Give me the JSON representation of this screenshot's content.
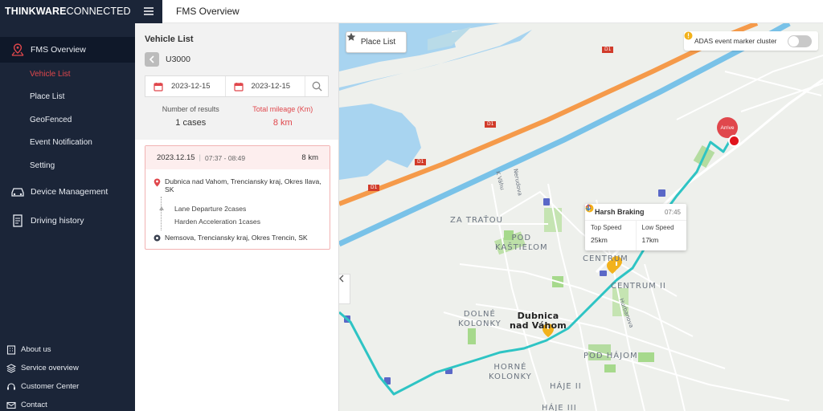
{
  "brand": {
    "bold": "THINKWARE",
    "light": "CONNECTED"
  },
  "header": {
    "title": "FMS Overview"
  },
  "sidebar": {
    "main_label": "FMS Overview",
    "sub_items": [
      {
        "label": "Vehicle List"
      },
      {
        "label": "Place List"
      },
      {
        "label": "GeoFenced"
      },
      {
        "label": "Event Notification"
      },
      {
        "label": "Setting"
      }
    ],
    "device_management": "Device Management",
    "driving_history": "Driving history",
    "bottom_links": [
      {
        "label": "About us",
        "icon": "building-icon"
      },
      {
        "label": "Service overview",
        "icon": "layers-icon"
      },
      {
        "label": "Customer Center",
        "icon": "headset-icon"
      },
      {
        "label": "Contact",
        "icon": "mail-icon"
      }
    ]
  },
  "panel": {
    "title": "Vehicle List",
    "vehicle": "U3000",
    "date_from": "2023-12-15",
    "date_to": "2023-12-15",
    "stats": {
      "results_label": "Number of results",
      "results_value": "1 cases",
      "mileage_label": "Total mileage (Km)",
      "mileage_value": "8 km"
    },
    "trip": {
      "date": "2023.12.15",
      "time": "07:37 - 08:49",
      "distance": "8 km",
      "start": "Dubnica nad Vahom, Trenciansky kraj, Okres Ilava, SK",
      "events": [
        "Lane Departure 2cases",
        "Harden Acceleration 1cases"
      ],
      "end": "Nemsova, Trenciansky kraj, Okres Trencin, SK"
    }
  },
  "map": {
    "place_list_button": "Place List",
    "adas_toggle_label": "ADAS event marker cluster",
    "adas_toggle_on": false,
    "popup": {
      "title": "Harsh Braking",
      "time": "07:45",
      "top_speed_label": "Top Speed",
      "top_speed_value": "25km",
      "low_speed_label": "Low Speed",
      "low_speed_value": "17km"
    },
    "arrive_label": "Arrive",
    "road_labels": [
      "D1",
      "D1",
      "D1",
      "D1",
      "D1"
    ],
    "place_labels": {
      "za_tratou": "ZA TRAŤOU",
      "pod_kastielom": "POD\nKAŠTIEĽOM",
      "centrum": "CENTRUM",
      "centrum_ii": "CENTRUM II",
      "dolne_kolonky": "DOLNÉ\nKOLONKY",
      "dubnica": "Dubnica\nnad Váhom",
      "pod_hajom": "POD HÁJOM",
      "horne_kolonky": "HORNÉ\nKOLONKY",
      "haje_ii": "HÁJE II",
      "haje_iii": "HÁJE III"
    },
    "street_labels": [
      "K Váhu",
      "Nerudova",
      "Hurbanova"
    ],
    "colors": {
      "route": "#2ec4c4",
      "highway_orange": "#f59a4a",
      "highway_blue": "#79c2e8",
      "water": "#a8d4f0",
      "accent_red": "#e0474c"
    }
  }
}
